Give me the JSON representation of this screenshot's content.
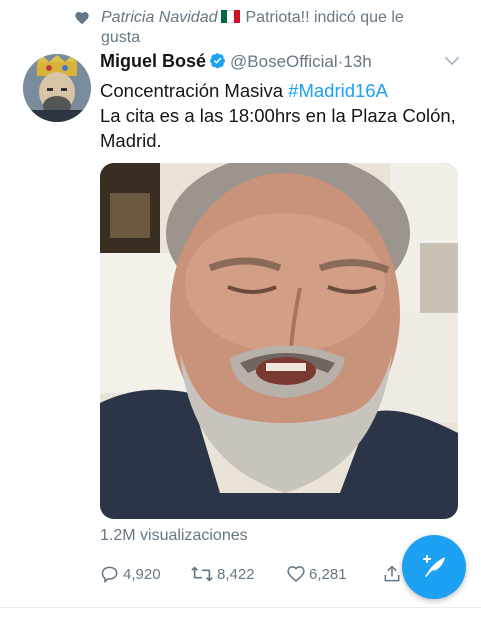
{
  "liked": {
    "name": "Patricia Navidad",
    "text": "Patriota!! indicó que le gusta",
    "flag_colors": [
      "#006847",
      "#ffffff",
      "#ce1126"
    ]
  },
  "tweet": {
    "author_name": "Miguel Bosé",
    "handle": "@BoseOfficial",
    "time": "·13h",
    "verified": true,
    "text_line1": "Concentración Masiva ",
    "hashtag": "#Madrid16A",
    "text_line2": "La cita es a las 18:00hrs en la Plaza Colón, Madrid.",
    "views": "1.2M visualizaciones"
  },
  "actions": {
    "replies": "4,920",
    "retweets": "8,422",
    "likes": "6,281"
  },
  "icons": {
    "liked": "heart-icon",
    "verified": "verified-badge-icon",
    "more": "chevron-down-icon",
    "reply": "reply-icon",
    "retweet": "retweet-icon",
    "like": "heart-icon",
    "share": "share-icon",
    "compose": "compose-feather-icon"
  },
  "colors": {
    "accent": "#1da1f2",
    "secondary_text": "#657786",
    "primary_text": "#14171a"
  }
}
